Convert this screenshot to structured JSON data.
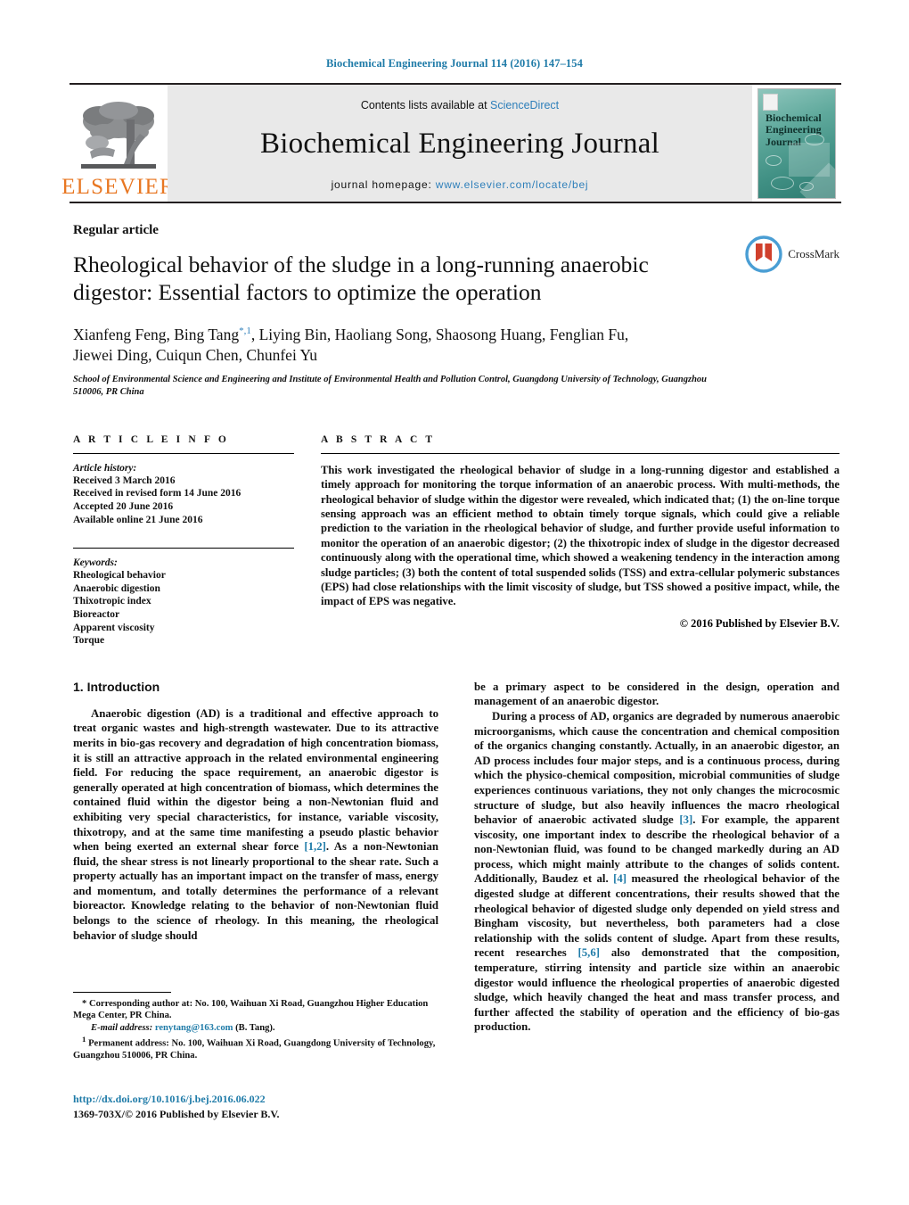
{
  "running_head": "Biochemical Engineering Journal 114 (2016) 147–154",
  "masthead": {
    "contents_prefix": "Contents lists available at ",
    "contents_link": "ScienceDirect",
    "journal_name": "Biochemical Engineering Journal",
    "homepage_label": "journal homepage:",
    "homepage_url": "www.elsevier.com/locate/bej",
    "publisher_word": "ELSEVIER",
    "cover_title_line1": "Biochemical",
    "cover_title_line2": "Engineering",
    "cover_title_line3": "Journal"
  },
  "article": {
    "type": "Regular article",
    "title": "Rheological behavior of the sludge in a long-running anaerobic digestor: Essential factors to optimize the operation",
    "authors_line1_pre": "Xianfeng Feng, Bing Tang",
    "authors_marker_star": "*",
    "authors_marker_one": "1",
    "authors_line1_post": ", Liying Bin, Haoliang Song, Shaosong Huang, Fenglian Fu,",
    "authors_line2": "Jiewei Ding, Cuiqun Chen, Chunfei Yu",
    "affiliation": "School of Environmental Science and Engineering and Institute of Environmental Health and Pollution Control, Guangdong University of Technology, Guangzhou 510006, PR China",
    "crossmark_label": "CrossMark"
  },
  "article_info": {
    "heading": "A R T I C L E    I N F O",
    "history_heading": "Article history:",
    "history": [
      "Received 3 March 2016",
      "Received in revised form 14 June 2016",
      "Accepted 20 June 2016",
      "Available online 21 June 2016"
    ],
    "keywords_heading": "Keywords:",
    "keywords": [
      "Rheological behavior",
      "Anaerobic digestion",
      "Thixotropic index",
      "Bioreactor",
      "Apparent viscosity",
      "Torque"
    ]
  },
  "abstract": {
    "heading": "A B S T R A C T",
    "text": "This work investigated the rheological behavior of sludge in a long-running digestor and established a timely approach for monitoring the torque information of an anaerobic process. With multi-methods, the rheological behavior of sludge within the digestor were revealed, which indicated that; (1) the on-line torque sensing approach was an efficient method to obtain timely torque signals, which could give a reliable prediction to the variation in the rheological behavior of sludge, and further provide useful information to monitor the operation of an anaerobic digestor; (2) the thixotropic index of sludge in the digestor decreased continuously along with the operational time, which showed a weakening tendency in the interaction among sludge particles; (3) both the content of total suspended solids (TSS) and extra-cellular polymeric substances (EPS) had close relationships with the limit viscosity of sludge, but TSS showed a positive impact, while, the impact of EPS was negative.",
    "copyright": "© 2016 Published by Elsevier B.V."
  },
  "introduction": {
    "heading": "1.  Introduction",
    "left_p1_a": "Anaerobic digestion (AD) is a traditional and effective approach to treat organic wastes and high-strength wastewater. Due to its attractive merits in bio-gas recovery and degradation of high concentration biomass, it is still an attractive approach in the related environmental engineering field. For reducing the space requirement, an anaerobic digestor is generally operated at high concentration of biomass, which determines the contained fluid within the digestor being a non-Newtonian fluid and exhibiting very special characteristics, for instance, variable viscosity, thixotropy, and at the same time manifesting a pseudo plastic behavior when being exerted an external shear force ",
    "left_ref1": "[1,2]",
    "left_p1_b": ". As a non-Newtonian fluid, the shear stress is not linearly proportional to the shear rate. Such a property actually has an important impact on the transfer of mass, energy and momentum, and totally determines the performance of a relevant bioreactor. Knowledge relating to the behavior of non-Newtonian fluid belongs to the science of rheology. In this meaning, the rheological behavior of sludge should",
    "right_p1": "be a primary aspect to be considered in the design, operation and management of an anaerobic digestor.",
    "right_p2_a": "During a process of AD, organics are degraded by numerous anaerobic microorganisms, which cause the concentration and chemical composition of the organics changing constantly. Actually, in an anaerobic digestor, an AD process includes four major steps, and is a continuous process, during which the physico-chemical composition, microbial communities of sludge experiences continuous variations, they not only changes the microcosmic structure of sludge, but also heavily influences the macro rheological behavior of anaerobic activated sludge ",
    "right_ref3": "[3]",
    "right_p2_b": ". For example, the apparent viscosity, one important index to describe the rheological behavior of a non-Newtonian fluid, was found to be changed markedly during an AD process, which might mainly attribute to the changes of solids content. Additionally, Baudez et al. ",
    "right_ref4": "[4]",
    "right_p2_c": " measured the rheological behavior of the digested sludge at different concentrations, their results showed that the rheological behavior of digested sludge only depended on yield stress and Bingham viscosity, but nevertheless, both parameters had a close relationship with the solids content of sludge. Apart from these results, recent researches ",
    "right_ref56": "[5,6]",
    "right_p2_d": " also demonstrated that the composition, temperature, stirring intensity and particle size within an anaerobic digestor would influence the rheological properties of anaerobic digested sludge, which heavily changed the heat and mass transfer process, and further affected the stability of operation and the efficiency of bio-gas production."
  },
  "footnotes": {
    "corresponding": "* Corresponding author at: No. 100, Waihuan Xi Road, Guangzhou Higher Education Mega Center, PR China.",
    "email_label": "E-mail address:",
    "email": "renytang@163.com",
    "email_owner": "(B. Tang).",
    "permanent_marker": "1",
    "permanent": "Permanent address: No. 100, Waihuan Xi Road, Guangdong University of Technology, Guangzhou 510006, PR China.",
    "doi": "http://dx.doi.org/10.1016/j.bej.2016.06.022",
    "issn": "1369-703X/© 2016 Published by Elsevier B.V."
  },
  "colors": {
    "link": "#1f7ba8",
    "elsevier_orange": "#E87722",
    "mast_grey": "#e9e9e9"
  }
}
